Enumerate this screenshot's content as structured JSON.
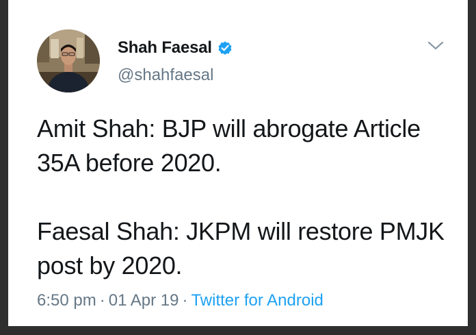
{
  "tweet": {
    "author": {
      "display_name": "Shah Faesal",
      "handle": "@shahfaesal",
      "verified": true
    },
    "text_paragraph_1": "Amit Shah: BJP will abrogate Article 35A before 2020.",
    "text_paragraph_2": "Faesal Shah: JKPM will restore PMJK post by 2020.",
    "time": "6:50 pm",
    "separator": "·",
    "date": "01 Apr 19",
    "source": "Twitter for Android"
  },
  "icons": {
    "verified": "verified-badge-icon",
    "menu": "chevron-down-icon"
  },
  "colors": {
    "text_primary": "#14171a",
    "text_secondary": "#657786",
    "link": "#1da1f2",
    "verified_badge": "#1da1f2"
  }
}
